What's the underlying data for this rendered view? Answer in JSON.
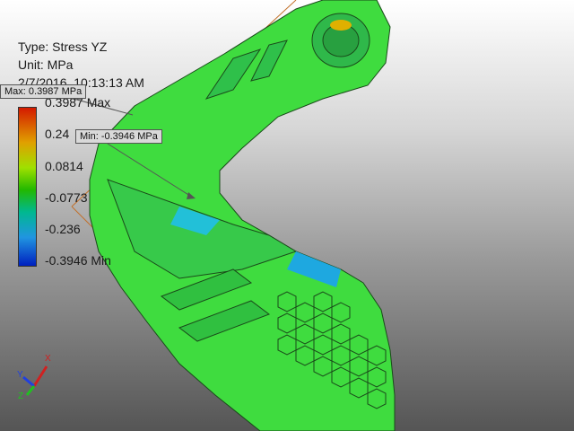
{
  "result": {
    "type_label": "Type: Stress YZ",
    "unit_label": "Unit: MPa",
    "timestamp": "2/7/2016, 10:13:13 AM"
  },
  "legend": {
    "max_label": "0.3987 Max",
    "min_label": "-0.3946 Min",
    "ticks": [
      "0.24",
      "0.0814",
      "-0.0773",
      "-0.236"
    ],
    "colors": [
      "#d41a00",
      "#e0a000",
      "#9fe000",
      "#22b800",
      "#00b890",
      "#2095e0",
      "#0020c0"
    ]
  },
  "probes": {
    "max": "Max: 0.3987 MPa",
    "min": "Min: -0.3946 MPa"
  },
  "triad": {
    "x_label": "X",
    "y_label": "Y",
    "z_label": "Z"
  },
  "colors": {
    "part_green": "#3fdc3f",
    "background_top": "#ffffff",
    "background_bottom": "#555555"
  }
}
